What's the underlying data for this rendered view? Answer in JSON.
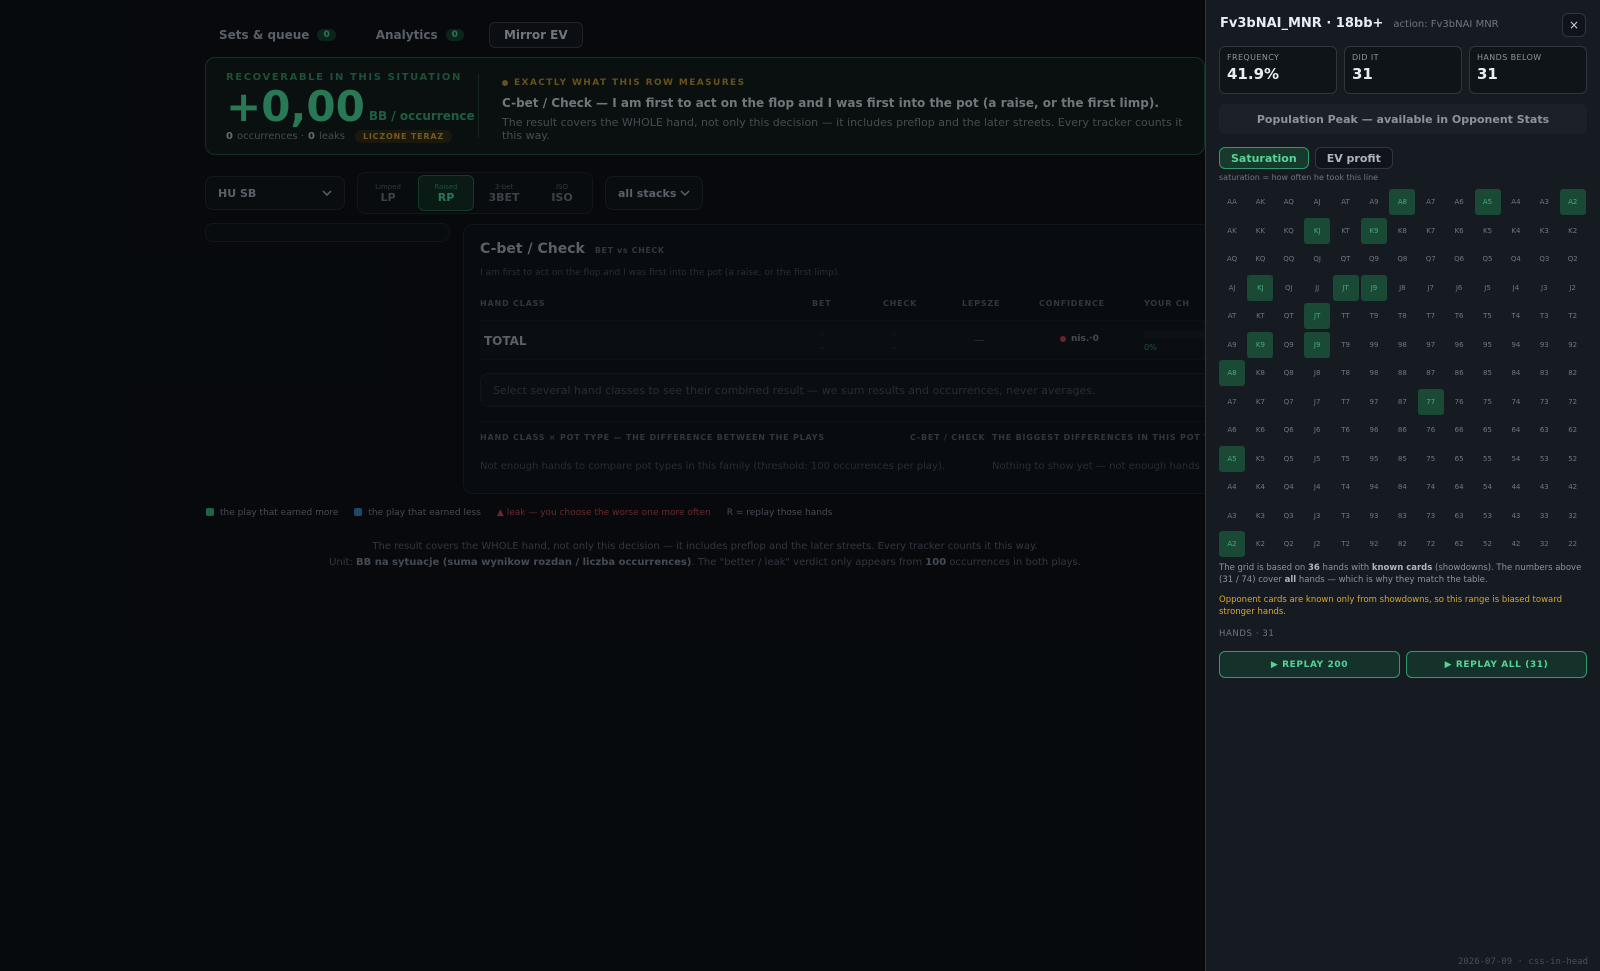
{
  "nav": {
    "tabs": [
      {
        "label": "Sets & queue",
        "count": "0"
      },
      {
        "label": "Analytics",
        "count": "0"
      },
      {
        "label": "Mirror EV"
      }
    ]
  },
  "hero": {
    "eyebrow": "RECOVERABLE IN THIS SITUATION",
    "value": "+0,00",
    "unit": "BB / occurrence",
    "occurrences": "0",
    "occurrences_label": "occurrences ·",
    "leaks": "0",
    "leaks_label": "leaks",
    "badge": "LICZONE TERAZ",
    "measure_eyebrow": "EXACTLY WHAT THIS ROW MEASURES",
    "measure_title": "C-bet / Check — I am first to act on the flop and I was first into the pot (a raise, or the first limp).",
    "measure_text": "The result covers the WHOLE hand, not only this decision — it includes preflop and the later streets. Every tracker counts it this way."
  },
  "filters": {
    "position": "HU SB",
    "pot_types": [
      {
        "small": "Limped",
        "label": "LP"
      },
      {
        "small": "Raised",
        "label": "RP"
      },
      {
        "small": "3-bet",
        "label": "3BET"
      },
      {
        "small": "ISO",
        "label": "ISO"
      }
    ],
    "stacks": "all stacks"
  },
  "card": {
    "title": "C-bet / Check",
    "tag": "BET vs CHECK",
    "subtitle": "I am first to act on the flop and I was first into the pot (a raise, or the first limp).",
    "columns": [
      "HAND CLASS",
      "BET",
      "CHECK",
      "LEPSZE",
      "CONFIDENCE",
      "YOUR CH"
    ],
    "total": "TOTAL",
    "dash": "–",
    "em_dash": "—",
    "confidence": "nis.·0",
    "pct": "0%",
    "hint": "Select several hand classes to see their combined result — we sum results and occurrences, never averages.",
    "sect_left": "HAND CLASS × POT TYPE — THE DIFFERENCE BETWEEN THE PLAYS",
    "sect_mid": "C-BET / CHECK",
    "sect_right": "THE BIGGEST DIFFERENCES IN THIS POT T",
    "left_text": "Not enough hands to compare pot types in this family (threshold: 100 occurrences per play).",
    "right_text": "Nothing to show yet — not enough hands"
  },
  "legend": {
    "more": "the play that earned more",
    "less": "the play that earned less",
    "leak": "▲ leak — you choose the worse one more often",
    "replay": "R = replay those hands",
    "color_more": "#2f9a6e",
    "color_less": "#2f6fa0"
  },
  "footer": {
    "line1": "The result covers the WHOLE hand, not only this decision — it includes preflop and the later streets. Every tracker counts it this way.",
    "unit_prefix": "Unit: ",
    "unit_bold": "BB na sytuacje (suma wynikow rozdan / liczba occurrences)",
    "unit_mid": ". The \"better / leak\" verdict only appears from ",
    "unit_num": "100",
    "unit_suffix": " occurrences in both plays."
  },
  "panel": {
    "title": "Fv3bNAI_MNR · 18bb+",
    "action": "action: Fv3bNAI MNR",
    "close": "×",
    "stats": [
      {
        "label": "FREQUENCY",
        "value": "41.9%"
      },
      {
        "label": "DID IT",
        "value": "31"
      },
      {
        "label": "HANDS BELOW",
        "value": "31"
      }
    ],
    "peak": "Population Peak — available in Opponent Stats",
    "modes": [
      "Saturation",
      "EV profit"
    ],
    "mode_caption": "saturation = how often he took this line",
    "highlighted": [
      "KJ",
      "JT",
      "K9",
      "J9",
      "A8",
      "77",
      "A5",
      "A2"
    ],
    "note_a": "The grid is based on ",
    "note_hands": "36",
    "note_b": " hands with ",
    "note_known": "known cards",
    "note_c": " (showdowns). The numbers above (31 / 74) cover ",
    "note_all": "all",
    "note_d": " hands — which is why they match the table.",
    "warning": "Opponent cards are known only from showdowns, so this range is biased toward stronger hands.",
    "hands_label": "HANDS · 31",
    "replay_200": "▶ REPLAY 200",
    "replay_all": "▶ REPLAY ALL (31)",
    "stamp": "2026-07-09 · css-in-head",
    "accent": "#56d39a",
    "highlight_color": "#1a4a36"
  }
}
